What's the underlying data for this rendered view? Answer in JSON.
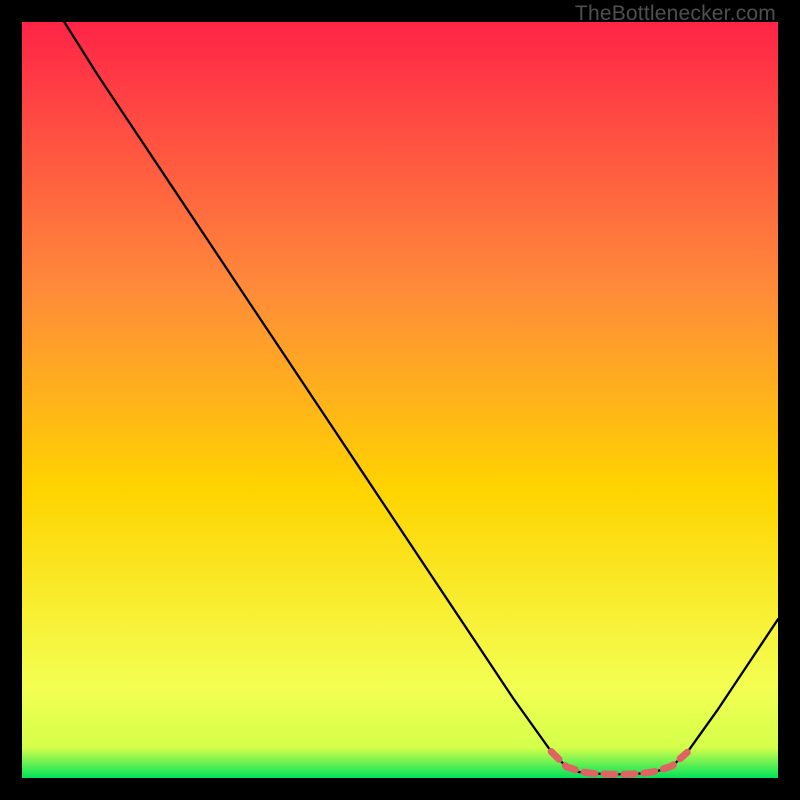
{
  "watermark": "TheBottlenecker.com",
  "chart_data": {
    "type": "line",
    "title": "",
    "xlabel": "",
    "ylabel": "",
    "xlim": [
      0,
      100
    ],
    "ylim": [
      0,
      100
    ],
    "grid": false,
    "background_gradient": {
      "top": "#ff2447",
      "mid": "#ffd400",
      "bottom": "#00e25a"
    },
    "series": [
      {
        "name": "bottleneck-curve",
        "stroke": "#000000",
        "stroke_width": 2.3,
        "x": [
          5.6,
          10,
          15,
          20,
          25,
          30,
          35,
          40,
          45,
          50,
          55,
          60,
          65,
          70,
          72,
          73,
          75,
          78,
          80,
          82,
          84,
          86,
          88,
          92,
          96,
          100
        ],
        "values": [
          100,
          93,
          85.5,
          78,
          70.5,
          63,
          55.5,
          48,
          40.5,
          33,
          25.5,
          18,
          10.5,
          3.5,
          1.5,
          0.9,
          0.6,
          0.5,
          0.5,
          0.6,
          0.9,
          1.6,
          3.4,
          9,
          15,
          21
        ]
      },
      {
        "name": "optimal-zone-highlight",
        "stroke": "#e06262",
        "stroke_width": 7,
        "dash": true,
        "x": [
          70,
          72,
          74,
          76,
          78,
          80,
          82,
          84,
          86,
          88
        ],
        "values": [
          3.5,
          1.5,
          0.8,
          0.55,
          0.5,
          0.5,
          0.6,
          0.9,
          1.6,
          3.4
        ]
      }
    ]
  }
}
